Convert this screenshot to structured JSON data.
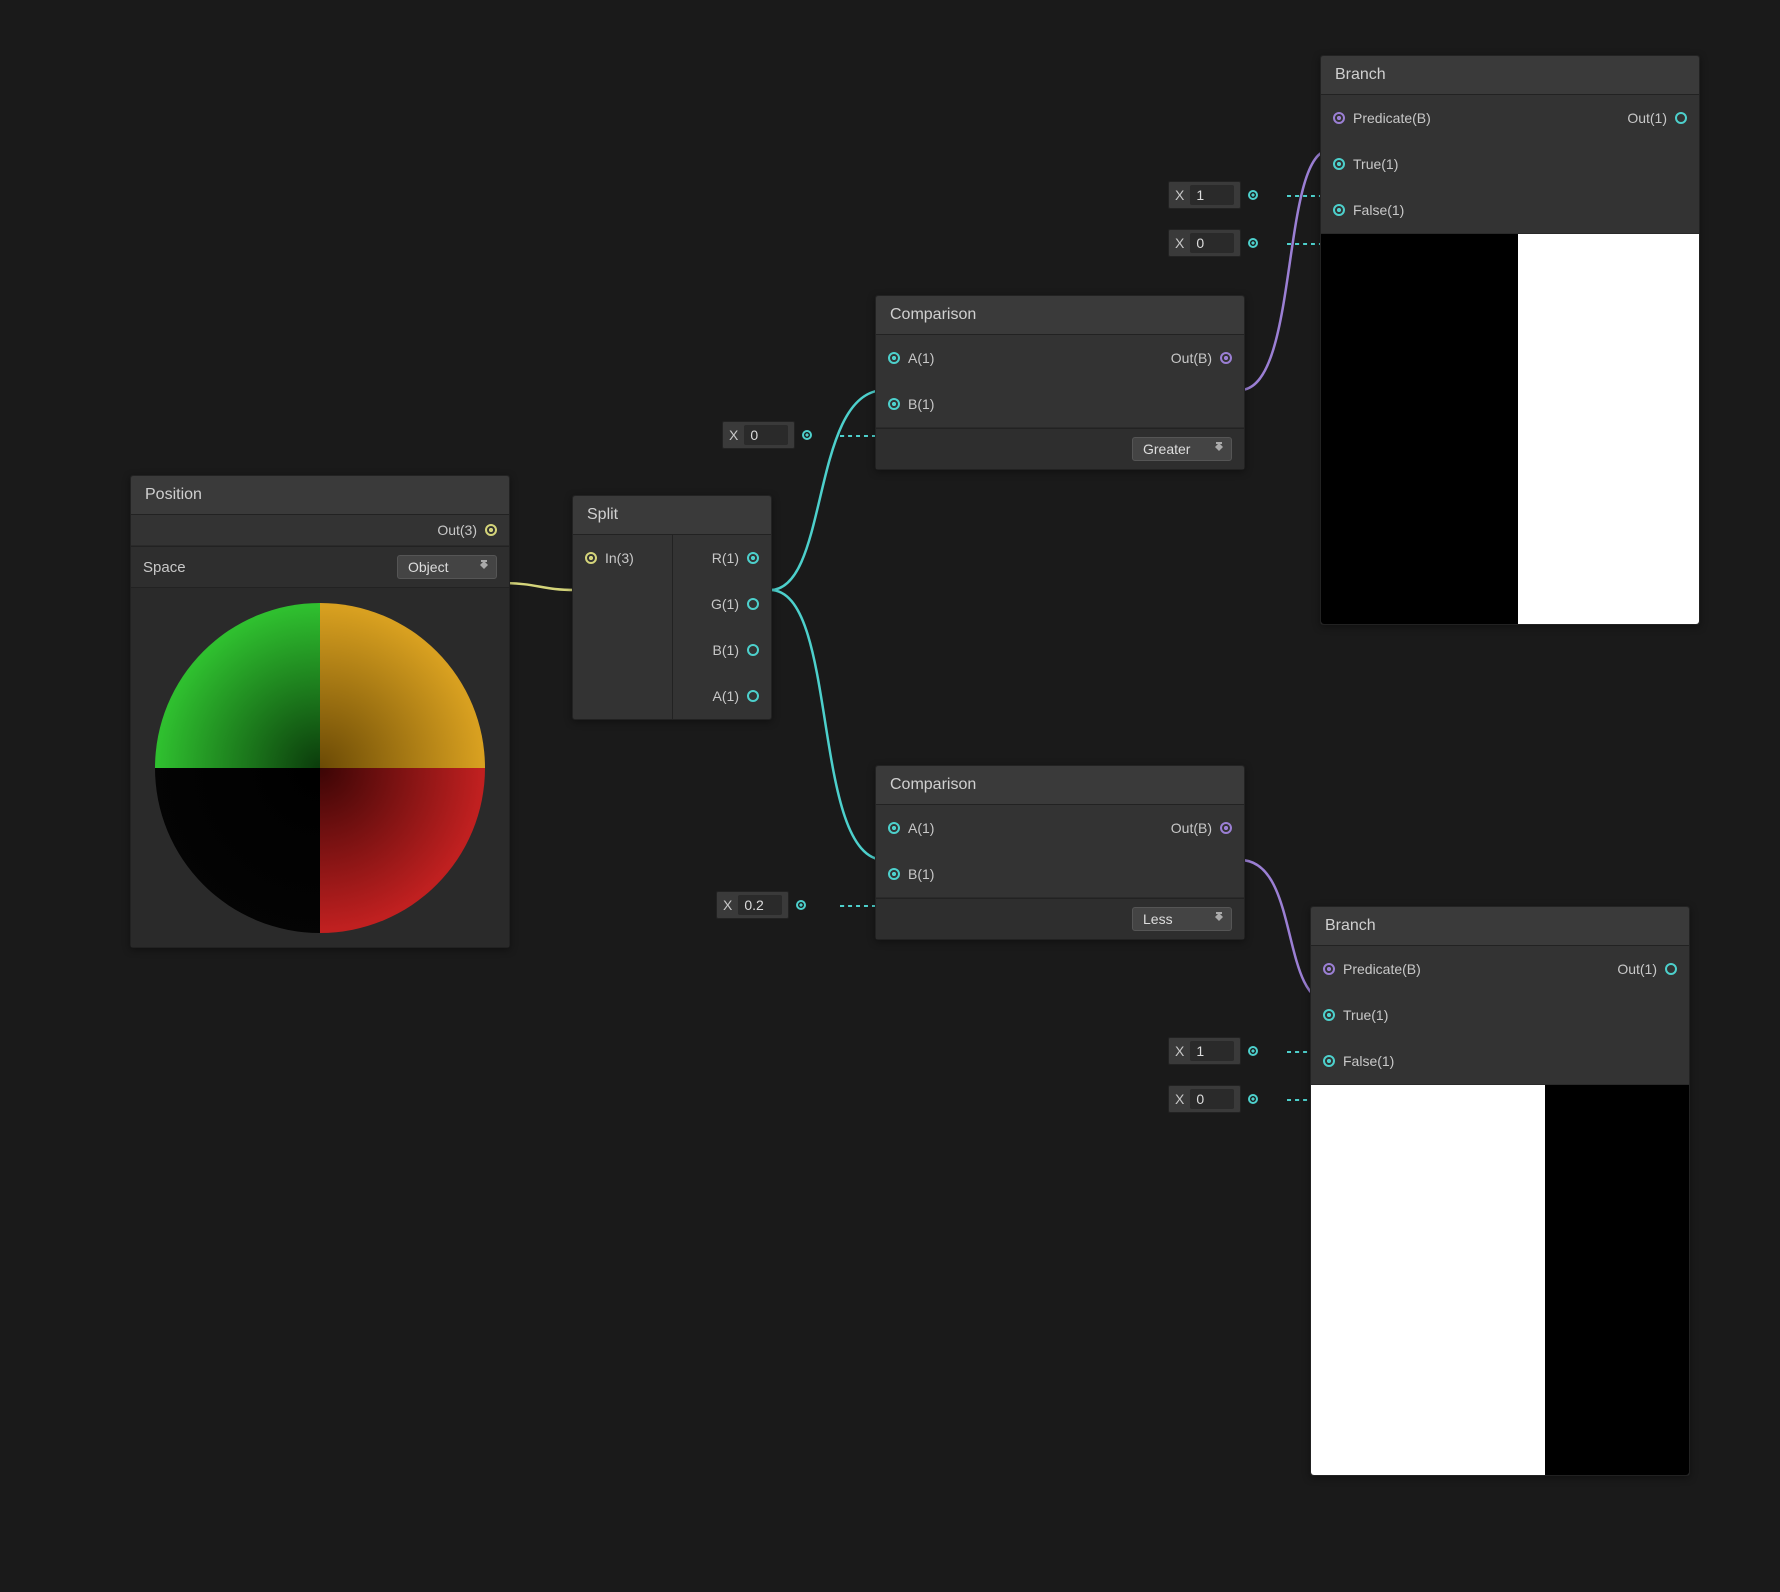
{
  "nodes": {
    "position": {
      "title": "Position",
      "out_label": "Out(3)",
      "space_label": "Space",
      "space_value": "Object"
    },
    "split": {
      "title": "Split",
      "in_label": "In(3)",
      "r_label": "R(1)",
      "g_label": "G(1)",
      "b_label": "B(1)",
      "a_label": "A(1)"
    },
    "comparison1": {
      "title": "Comparison",
      "a_label": "A(1)",
      "b_label": "B(1)",
      "out_label": "Out(B)",
      "mode": "Greater"
    },
    "comparison2": {
      "title": "Comparison",
      "a_label": "A(1)",
      "b_label": "B(1)",
      "out_label": "Out(B)",
      "mode": "Less"
    },
    "branch1": {
      "title": "Branch",
      "predicate_label": "Predicate(B)",
      "true_label": "True(1)",
      "false_label": "False(1)",
      "out_label": "Out(1)"
    },
    "branch2": {
      "title": "Branch",
      "predicate_label": "Predicate(B)",
      "true_label": "True(1)",
      "false_label": "False(1)",
      "out_label": "Out(1)"
    }
  },
  "float_inputs": {
    "comp1_b": {
      "x": "X",
      "value": "0"
    },
    "comp2_b": {
      "x": "X",
      "value": "0.2"
    },
    "branch1_true": {
      "x": "X",
      "value": "1"
    },
    "branch1_false": {
      "x": "X",
      "value": "0"
    },
    "branch2_true": {
      "x": "X",
      "value": "1"
    },
    "branch2_false": {
      "x": "X",
      "value": "0"
    }
  },
  "colors": {
    "wire_teal": "#4dd0cc",
    "wire_yellow": "#d4d47a",
    "wire_purple": "#9b7fd4"
  }
}
